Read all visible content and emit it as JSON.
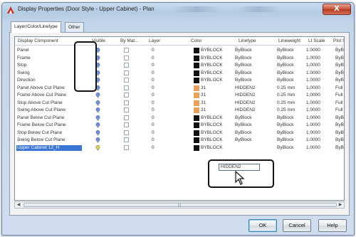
{
  "window": {
    "title": "Display Properties (Door Style - Upper Cabinet) - Plan",
    "close_label": "X"
  },
  "tabs": [
    {
      "label": "Layer/Color/Linetype",
      "active": true
    },
    {
      "label": "Other",
      "active": false
    }
  ],
  "grid": {
    "headers": {
      "name": "Display Component",
      "visible": "Visible",
      "by_material": "By Mat...",
      "layer": "Layer",
      "color": "Color",
      "linetype": "Linetype",
      "lineweight": "Lineweight",
      "lt_scale": "Lt Scale",
      "plot_style": "Plot Style"
    },
    "rows": [
      {
        "name": "Panel",
        "layer": "0",
        "swatch": "#111111",
        "color": "BYBLOCK",
        "linetype": "ByBlock",
        "lineweight": "ByBlock",
        "lt_scale": "1.0000",
        "plot_style": "ByBlock",
        "bulb": "blue"
      },
      {
        "name": "Frame",
        "layer": "0",
        "swatch": "#111111",
        "color": "BYBLOCK",
        "linetype": "ByBlock",
        "lineweight": "ByBlock",
        "lt_scale": "1.0000",
        "plot_style": "ByBlock",
        "bulb": "blue"
      },
      {
        "name": "Stop",
        "layer": "0",
        "swatch": "#111111",
        "color": "BYBLOCK",
        "linetype": "ByBlock",
        "lineweight": "ByBlock",
        "lt_scale": "1.0000",
        "plot_style": "ByBlock",
        "bulb": "blue"
      },
      {
        "name": "Swing",
        "layer": "0",
        "swatch": "#111111",
        "color": "BYBLOCK",
        "linetype": "ByBlock",
        "lineweight": "ByBlock",
        "lt_scale": "1.0000",
        "plot_style": "ByBlock",
        "bulb": "blue"
      },
      {
        "name": "Direction",
        "layer": "0",
        "swatch": "#111111",
        "color": "BYBLOCK",
        "linetype": "ByBlock",
        "lineweight": "ByBlock",
        "lt_scale": "1.0000",
        "plot_style": "ByBlock",
        "bulb": "blue"
      },
      {
        "name": "Panel Above Cut Plane",
        "layer": "0",
        "swatch": "#e8a15c",
        "color": "31",
        "linetype": "HIDDEN2",
        "lineweight": "0.25 mm",
        "lt_scale": "1.0000",
        "plot_style": "Full Satura",
        "bulb": "blue"
      },
      {
        "name": "Frame Above Cut Plane",
        "layer": "0",
        "swatch": "#e8a15c",
        "color": "31",
        "linetype": "HIDDEN2",
        "lineweight": "0.25 mm",
        "lt_scale": "1.0000",
        "plot_style": "Full Satura",
        "bulb": "blue"
      },
      {
        "name": "Stop Above Cut Plane",
        "layer": "0",
        "swatch": "#e8a15c",
        "color": "31",
        "linetype": "HIDDEN2",
        "lineweight": "0.25 mm",
        "lt_scale": "1.0000",
        "plot_style": "Full Satura",
        "bulb": "blue"
      },
      {
        "name": "Swing Above Cut Plane",
        "layer": "0",
        "swatch": "#e8a15c",
        "color": "31",
        "linetype": "HIDDEN2",
        "lineweight": "0.25 mm",
        "lt_scale": "1.0000",
        "plot_style": "Full Satura",
        "bulb": "blue"
      },
      {
        "name": "Panel Below Cut Plane",
        "layer": "0",
        "swatch": "#111111",
        "color": "BYBLOCK",
        "linetype": "ByBlock",
        "lineweight": "ByBlock",
        "lt_scale": "1.0000",
        "plot_style": "ByBlock",
        "bulb": "blue"
      },
      {
        "name": "Frame Below Cut Plane",
        "layer": "0",
        "swatch": "#111111",
        "color": "BYBLOCK",
        "linetype": "ByBlock",
        "lineweight": "ByBlock",
        "lt_scale": "1.0000",
        "plot_style": "ByBlock",
        "bulb": "blue"
      },
      {
        "name": "Stop Below Cut Plane",
        "layer": "0",
        "swatch": "#111111",
        "color": "BYBLOCK",
        "linetype": "ByBlock",
        "lineweight": "ByBlock",
        "lt_scale": "1.0000",
        "plot_style": "ByBlock",
        "bulb": "blue"
      },
      {
        "name": "Swing Below Cut Plane",
        "layer": "0",
        "swatch": "#111111",
        "color": "BYBLOCK",
        "linetype": "ByBlock",
        "lineweight": "ByBlock",
        "lt_scale": "1.0000",
        "plot_style": "ByBlock",
        "bulb": "blue"
      },
      {
        "name": "Upper Cabinet 12_H",
        "layer": "0",
        "swatch": "#111111",
        "color": "BYBLOCK",
        "linetype": "HIDDEN2",
        "lineweight": "ByBlock",
        "lt_scale": "1.0000",
        "plot_style": "ByBlock",
        "bulb": "yellow",
        "selected": true
      }
    ]
  },
  "buttons": {
    "ok": "OK",
    "cancel": "Cancel",
    "help": "Help"
  },
  "colors": {
    "selection": "#3a76d6",
    "bulb_on": "#6f8fd8",
    "bulb_active": "#f0d23c",
    "orange_swatch": "#e8a15c"
  }
}
